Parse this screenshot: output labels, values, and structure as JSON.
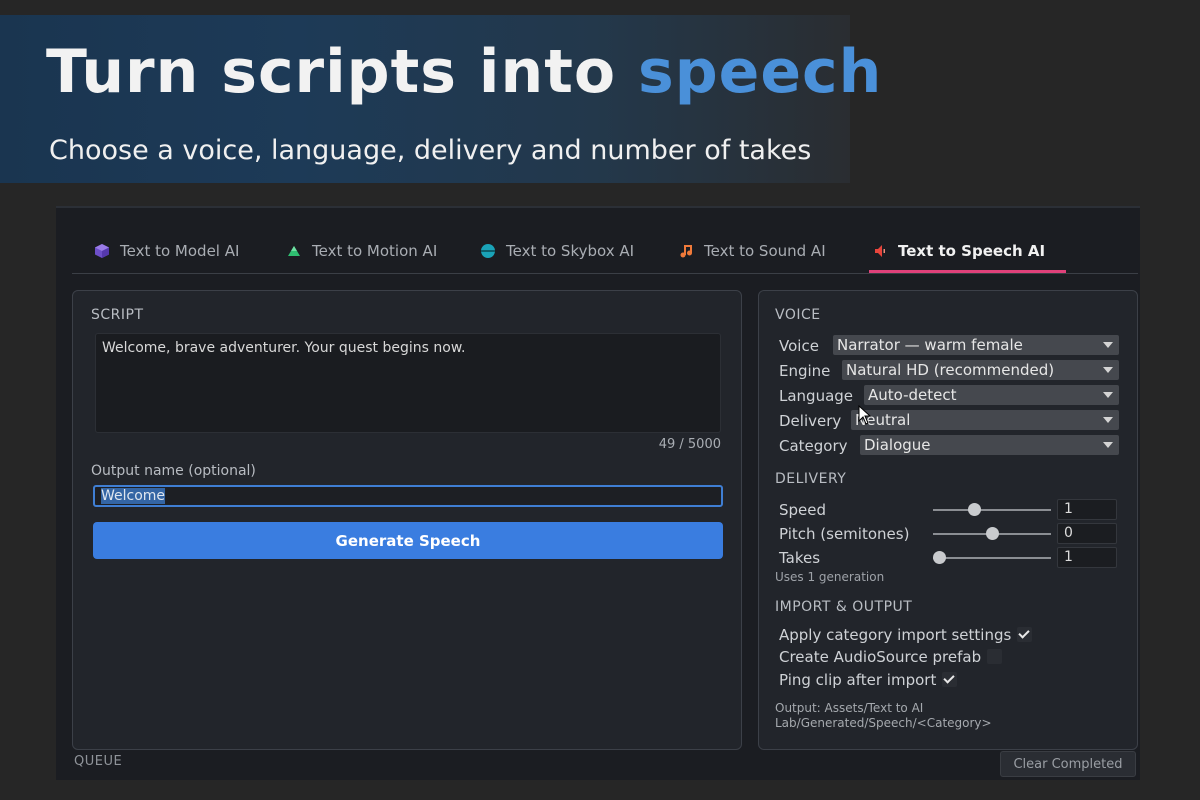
{
  "banner": {
    "headline_main": "Turn scripts into",
    "headline_accent": "speech",
    "subtitle": "Choose a voice, language, delivery and number of takes"
  },
  "tabs": [
    {
      "label": "Text to Model AI",
      "icon": "cube-icon",
      "color": "#7b5cd6"
    },
    {
      "label": "Text to Motion AI",
      "icon": "triangle-icon",
      "color": "#2fbf71"
    },
    {
      "label": "Text to Skybox AI",
      "icon": "sphere-icon",
      "color": "#1aa3b8"
    },
    {
      "label": "Text to Sound AI",
      "icon": "music-note-icon",
      "color": "#f07a3a"
    },
    {
      "label": "Text to Speech AI",
      "icon": "speaker-icon",
      "color": "#e8453c",
      "active": true
    }
  ],
  "script": {
    "title": "SCRIPT",
    "text": "Welcome, brave adventurer. Your quest begins now.",
    "counter": "49 / 5000",
    "output_label": "Output name (optional)",
    "output_value": "Welcome",
    "generate_label": "Generate Speech"
  },
  "voice": {
    "title": "VOICE",
    "fields": [
      {
        "label": "Voice",
        "value": "Narrator — warm female"
      },
      {
        "label": "Engine",
        "value": "Natural HD (recommended)"
      },
      {
        "label": "Language",
        "value": "Auto-detect"
      },
      {
        "label": "Delivery",
        "value": "Neutral"
      },
      {
        "label": "Category",
        "value": "Dialogue"
      }
    ]
  },
  "delivery": {
    "title": "DELIVERY",
    "sliders": [
      {
        "label": "Speed",
        "value": "1",
        "fraction": 0.35
      },
      {
        "label": "Pitch (semitones)",
        "value": "0",
        "fraction": 0.5
      },
      {
        "label": "Takes",
        "value": "1",
        "fraction": 0.05
      }
    ],
    "hint": "Uses 1 generation"
  },
  "import_output": {
    "title": "IMPORT & OUTPUT",
    "checks": [
      {
        "label": "Apply category import settings",
        "checked": true
      },
      {
        "label": "Create AudioSource prefab",
        "checked": false
      },
      {
        "label": "Ping clip after import",
        "checked": true
      }
    ],
    "output_path": "Output: Assets/Text to AI Lab/Generated/Speech/<Category>"
  },
  "queue": {
    "title": "QUEUE",
    "clear_label": "Clear Completed"
  },
  "colors": {
    "accent_blue": "#3a7de0",
    "tab_underline": "#e0417a",
    "headline_accent": "#4a90d9"
  }
}
